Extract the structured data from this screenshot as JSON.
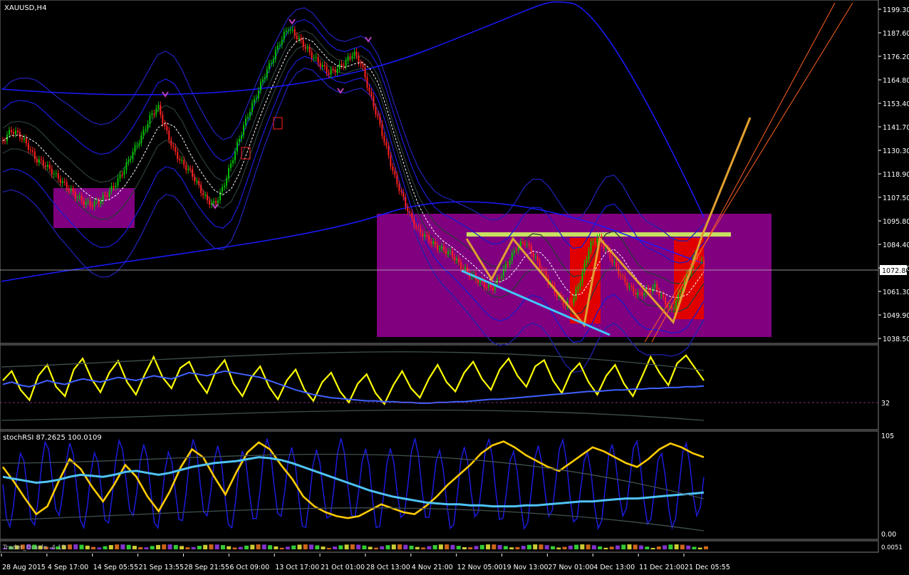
{
  "window": {
    "title": "XAUUSD,H4"
  },
  "chart_data": {
    "type": "line",
    "symbol": "XAUUSD",
    "timeframe": "H4",
    "price_axis": {
      "ticks": [
        "1199.30",
        "1187.60",
        "1176.20",
        "1164.80",
        "1153.40",
        "1141.70",
        "1130.30",
        "1118.90",
        "1107.50",
        "1095.80",
        "1084.40",
        "1072.80",
        "1061.30",
        "1049.90",
        "1038.50"
      ],
      "range": [
        1038.5,
        1199.3
      ],
      "current_price": "1072.80"
    },
    "time_axis": {
      "ticks": [
        "28 Aug 2015",
        "4 Sep 17:00",
        "14 Sep 05:55",
        "21 Sep 13:55",
        "28 Sep 21:55",
        "6 Oct 09:00",
        "13 Oct 17:00",
        "21 Oct 01:00",
        "28 Oct 13:00",
        "4 Nov 21:00",
        "12 Nov 05:00",
        "19 Nov 13:00",
        "27 Nov 01:00",
        "4 Dec 13:00",
        "11 Dec 21:00",
        "21 Dec 05:55"
      ]
    },
    "price_series": {
      "name": "XAUUSD",
      "values": [
        1135,
        1140,
        1138,
        1133,
        1126,
        1124,
        1120,
        1116,
        1112,
        1108,
        1105,
        1104,
        1106,
        1110,
        1115,
        1122,
        1130,
        1137,
        1146,
        1152,
        1140,
        1130,
        1124,
        1120,
        1113,
        1106,
        1104,
        1112,
        1124,
        1136,
        1147,
        1156,
        1166,
        1174,
        1183,
        1190,
        1186,
        1181,
        1176,
        1172,
        1168,
        1170,
        1173,
        1178,
        1172,
        1158,
        1146,
        1132,
        1118,
        1108,
        1098,
        1091,
        1088,
        1084,
        1082,
        1080,
        1075,
        1071,
        1068,
        1065,
        1063,
        1069,
        1076,
        1083,
        1086,
        1080,
        1073,
        1066,
        1060,
        1055,
        1058,
        1069,
        1084,
        1088,
        1082,
        1075,
        1068,
        1063,
        1060,
        1062,
        1064,
        1058,
        1052,
        1061,
        1070,
        1080,
        1074
      ]
    },
    "panels": [
      {
        "name": "panel-1",
        "axis_ticks": [
          "32"
        ],
        "series": [
          {
            "color": "#ffff00",
            "values": [
              60,
              72,
              48,
              35,
              66,
              80,
              52,
              40,
              74,
              88,
              62,
              45,
              70,
              85,
              58,
              42,
              68,
              90,
              64,
              50,
              76,
              84,
              60,
              44,
              72,
              86,
              56,
              40,
              64,
              78,
              52,
              36,
              60,
              74,
              48,
              34,
              58,
              70,
              46,
              32,
              56,
              68,
              44,
              30,
              54,
              72,
              50,
              38,
              62,
              80,
              58,
              46,
              70,
              84,
              62,
              48,
              74,
              88,
              66,
              52,
              78,
              86,
              60,
              44,
              70,
              82,
              58,
              42,
              66,
              80,
              56,
              40,
              64,
              90,
              70,
              54,
              82,
              92,
              76,
              60
            ]
          },
          {
            "color": "#4060ff",
            "values": [
              55,
              58,
              54,
              52,
              56,
              60,
              57,
              55,
              59,
              62,
              60,
              58,
              61,
              64,
              62,
              60,
              63,
              66,
              64,
              62,
              66,
              70,
              68,
              66,
              69,
              72,
              70,
              68,
              66,
              64,
              60,
              56,
              52,
              48,
              45,
              42,
              40,
              38,
              37,
              36,
              35,
              34,
              34,
              33,
              33,
              32,
              32,
              31,
              31,
              32,
              32,
              33,
              33,
              34,
              35,
              36,
              36,
              37,
              38,
              39,
              40,
              41,
              42,
              43,
              44,
              45,
              46,
              46,
              47,
              48,
              48,
              49,
              49,
              50,
              50,
              51,
              51,
              52,
              52,
              53
            ]
          }
        ]
      },
      {
        "name": "stochRSI",
        "label": "stochRSI 87.2625 100.0109",
        "axis_ticks": [
          "105",
          "0.00"
        ],
        "series": [
          {
            "color": "#ffcc00",
            "values": [
              70,
              55,
              38,
              22,
              30,
              55,
              78,
              68,
              50,
              35,
              52,
              72,
              60,
              40,
              25,
              45,
              70,
              88,
              80,
              60,
              42,
              65,
              85,
              95,
              88,
              72,
              58,
              40,
              30,
              24,
              20,
              18,
              20,
              26,
              32,
              28,
              24,
              22,
              30,
              40,
              52,
              62,
              72,
              84,
              92,
              96,
              90,
              82,
              76,
              70,
              66,
              74,
              82,
              90,
              86,
              80,
              74,
              70,
              78,
              88,
              94,
              90,
              84,
              80
            ]
          },
          {
            "color": "#4fc3f7",
            "values": [
              60,
              58,
              56,
              54,
              55,
              57,
              60,
              62,
              61,
              60,
              62,
              65,
              66,
              64,
              62,
              64,
              67,
              70,
              72,
              74,
              75,
              76,
              78,
              80,
              79,
              77,
              74,
              70,
              66,
              62,
              58,
              54,
              50,
              46,
              43,
              40,
              38,
              36,
              34,
              33,
              32,
              32,
              31,
              31,
              30,
              30,
              30,
              31,
              31,
              32,
              33,
              34,
              35,
              35,
              36,
              37,
              38,
              38,
              39,
              40,
              41,
              42,
              43,
              44
            ]
          }
        ]
      },
      {
        "name": "Trader_Oracle",
        "label": "Trader_Oracle -4.13",
        "axis_ticks": [
          "0.0051"
        ]
      }
    ],
    "annotations": [
      {
        "type": "rectangle",
        "color": "#800080"
      },
      {
        "type": "rectangle",
        "color": "#800080"
      },
      {
        "type": "zigzag",
        "color": "#e0a030"
      },
      {
        "type": "trendline",
        "color": "#40c8ff"
      },
      {
        "type": "neckline",
        "color": "#c8e060"
      }
    ],
    "grid": false
  },
  "colors": {
    "background": "#000000",
    "bull_candle": "#00c000",
    "bear_candle": "#ff2020",
    "bollinger": "#1a1aff",
    "box": "#800080",
    "red_zone": "#e00000",
    "zigzag": "#e0a030",
    "trend_blue": "#40c8ff",
    "neckline": "#c8e060",
    "fib_lines": "#ff6020",
    "current_price_line": "#c0c0c0"
  }
}
